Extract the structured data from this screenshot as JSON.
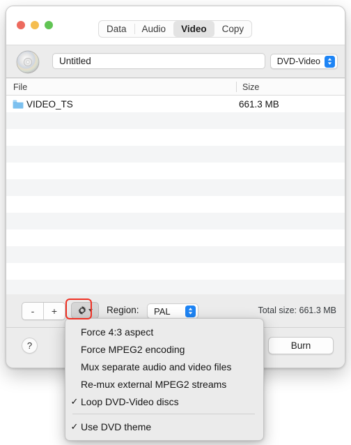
{
  "window": {
    "tabs": [
      {
        "label": "Data",
        "selected": false
      },
      {
        "label": "Audio",
        "selected": false
      },
      {
        "label": "Video",
        "selected": true
      },
      {
        "label": "Copy",
        "selected": false
      }
    ]
  },
  "name_row": {
    "disc_icon": "disc-icon",
    "name_value": "Untitled",
    "name_placeholder": "Untitled",
    "format_value": "DVD-Video"
  },
  "file_list": {
    "columns": [
      "File",
      "Size"
    ],
    "rows": [
      {
        "name": "VIDEO_TS",
        "size": "661.3 MB",
        "icon": "folder-icon"
      }
    ],
    "empty_row_count": 10
  },
  "toolbar": {
    "remove_label": "-",
    "add_label": "+",
    "gear_icon": "gear-icon",
    "region_label": "Region:",
    "region_value": "PAL",
    "total_size": "Total size: 661.3 MB"
  },
  "action_bar": {
    "help_label": "?",
    "burn_label": "Burn"
  },
  "gear_menu": {
    "items": [
      {
        "label": "Force 4:3 aspect",
        "checked": false,
        "separator_after": false
      },
      {
        "label": "Force MPEG2 encoding",
        "checked": false,
        "separator_after": false
      },
      {
        "label": "Mux separate audio and video files",
        "checked": false,
        "separator_after": false
      },
      {
        "label": "Re-mux external MPEG2 streams",
        "checked": false,
        "separator_after": false
      },
      {
        "label": "Loop DVD-Video discs",
        "checked": true,
        "separator_after": true
      },
      {
        "label": "Use DVD theme",
        "checked": true,
        "separator_after": false
      }
    ],
    "checkmark": "✓"
  },
  "colors": {
    "traffic_red": "#ed6a5e",
    "traffic_yellow": "#f5bd4f",
    "traffic_green": "#61c454",
    "accent_blue": "#1d84f5",
    "highlight_red": "#ef3124",
    "window_bg": "#ececec",
    "list_bg": "#ffffff",
    "alt_row": "#f4f5f6",
    "menu_bg": "#ebebeb"
  }
}
